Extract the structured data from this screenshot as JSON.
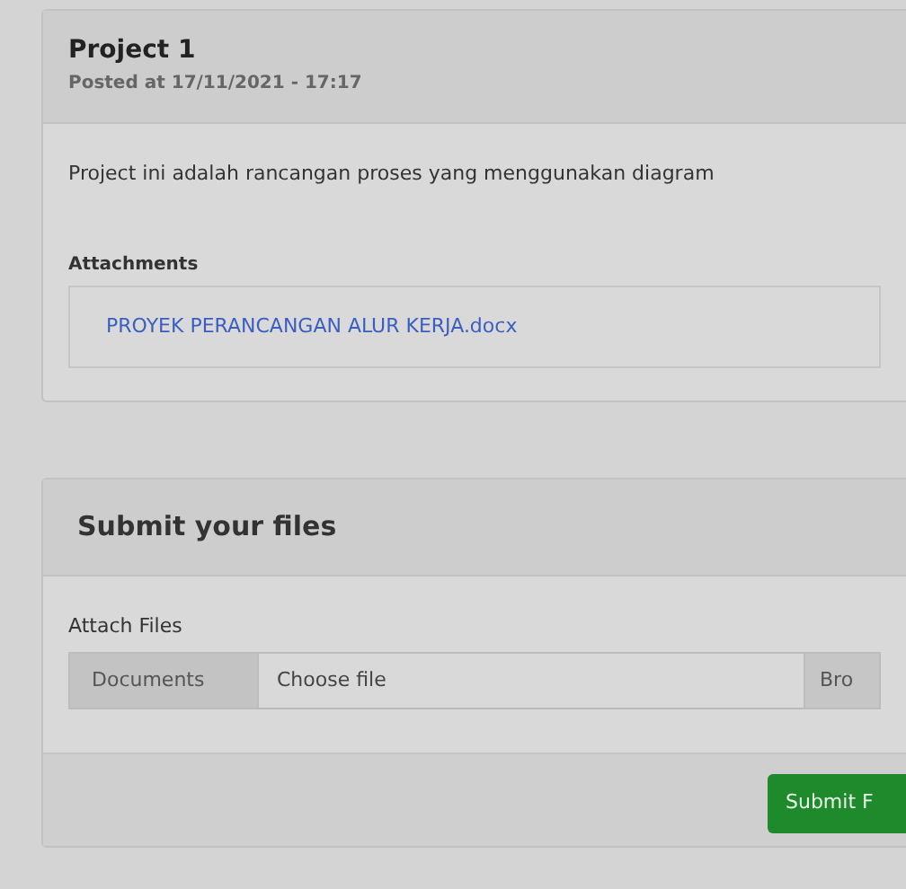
{
  "project": {
    "title": "Project 1",
    "posted": "Posted at 17/11/2021 - 17:17",
    "description": "Project ini adalah rancangan proses yang menggunakan diagram",
    "attachments_label": "Attachments",
    "attachments": [
      {
        "name": "PROYEK PERANCANGAN ALUR KERJA.docx"
      }
    ]
  },
  "submit": {
    "title": "Submit your files",
    "field_label": "Attach Files",
    "prefix": "Documents",
    "placeholder": "Choose file",
    "browse": "Bro",
    "button": "Submit F"
  }
}
